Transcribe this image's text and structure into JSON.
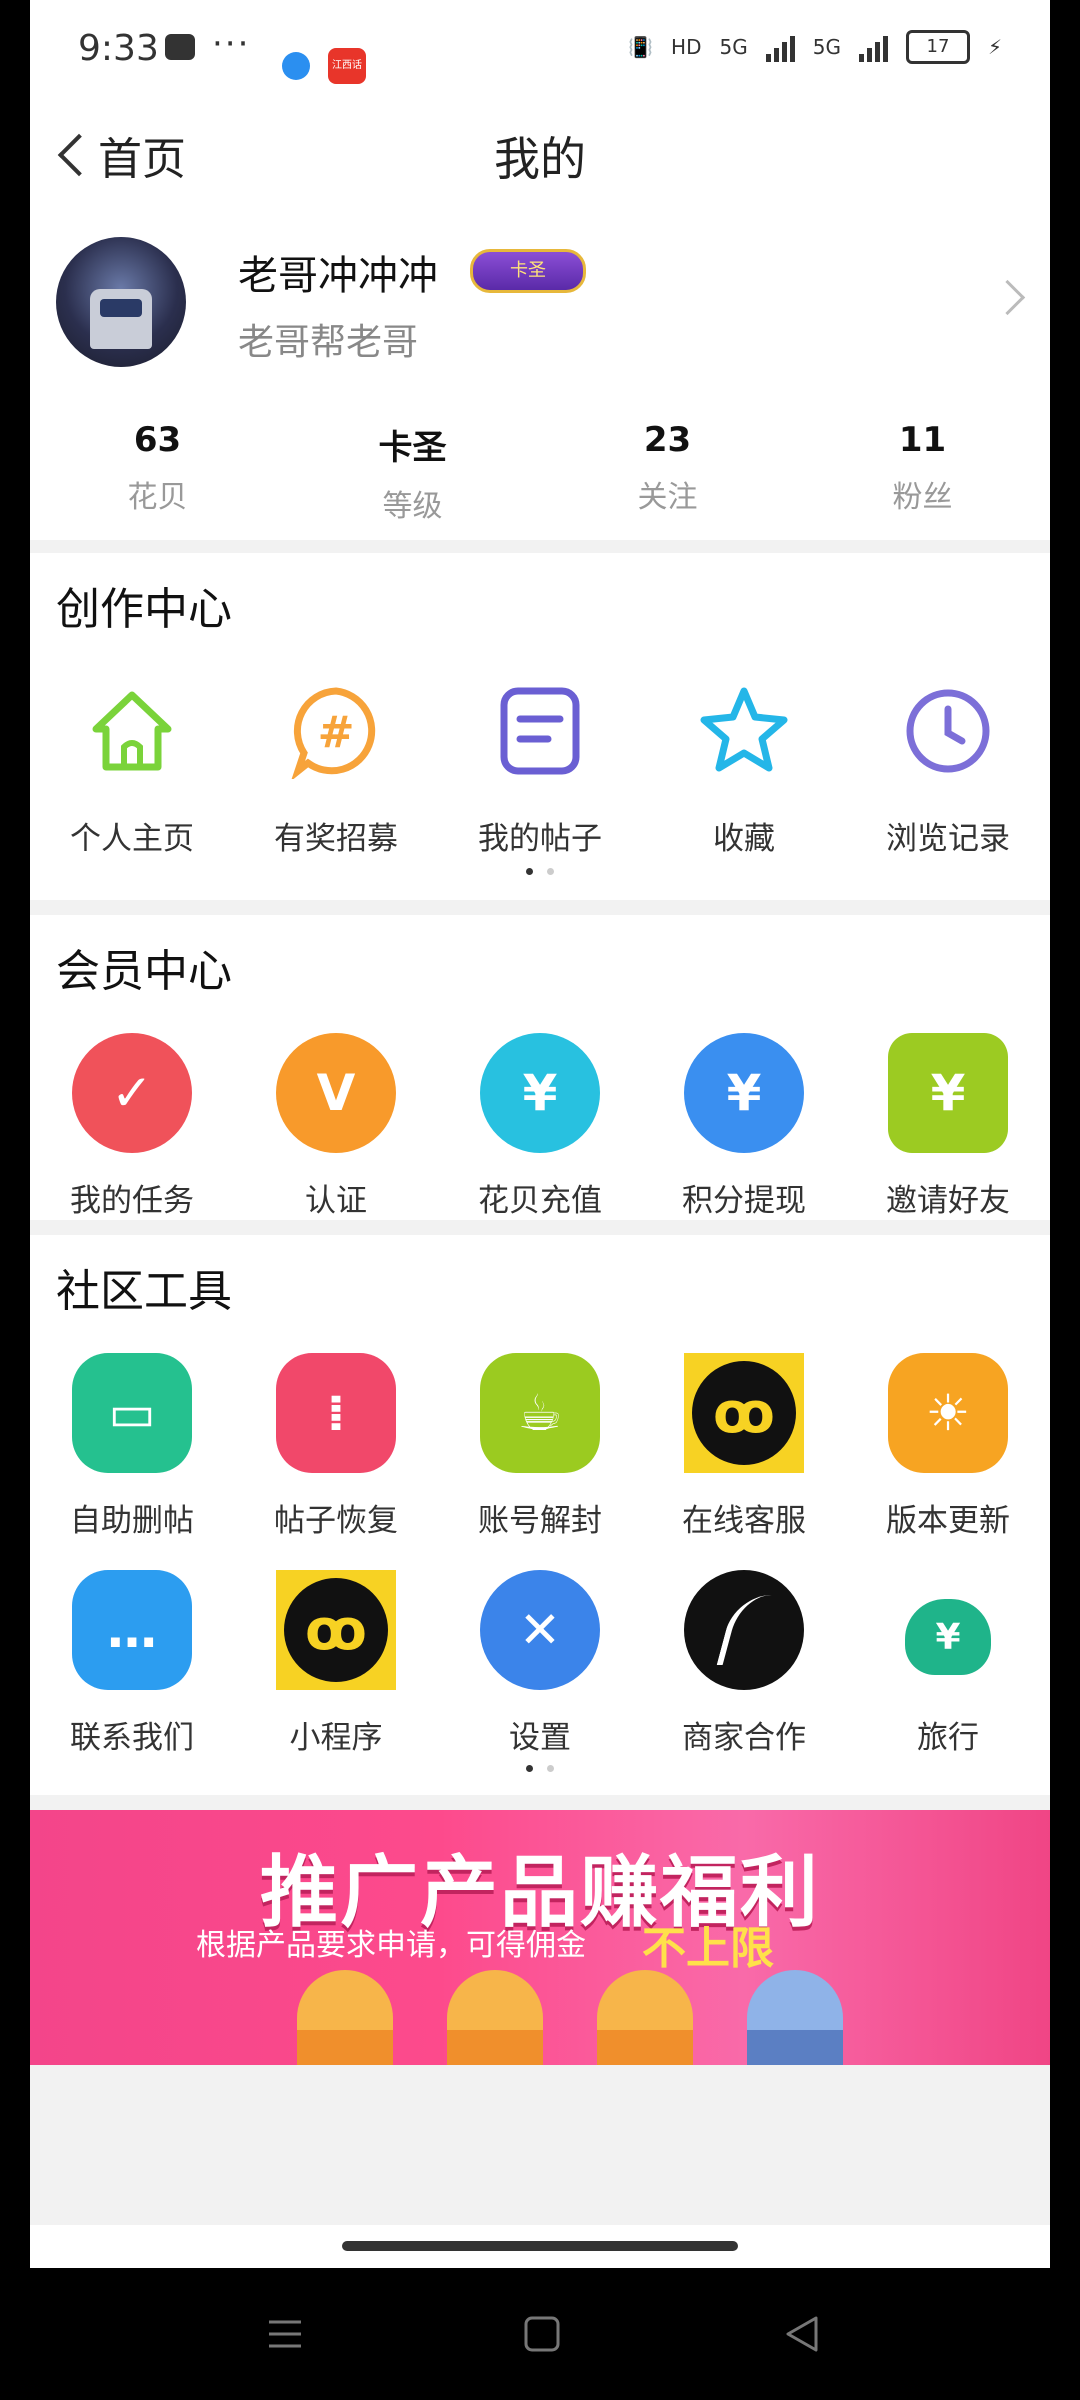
{
  "status_bar": {
    "time": "9:33",
    "dots": "···",
    "app2_label": "江西话",
    "network_hd": "HD",
    "net_5g_1": "5G",
    "net_5g_2": "5G",
    "battery": "17"
  },
  "nav": {
    "back_label": "首页",
    "title": "我的"
  },
  "profile": {
    "name": "老哥冲冲冲",
    "badge": "卡圣",
    "subtitle": "老哥帮老哥",
    "stats": [
      {
        "value": "63",
        "label": "花贝"
      },
      {
        "value": "卡圣",
        "label": "等级"
      },
      {
        "value": "23",
        "label": "关注"
      },
      {
        "value": "11",
        "label": "粉丝"
      }
    ]
  },
  "creation": {
    "title": "创作中心",
    "items": [
      {
        "label": "个人主页",
        "icon": "home-icon"
      },
      {
        "label": "有奖招募",
        "icon": "hashtag-icon"
      },
      {
        "label": "我的帖子",
        "icon": "note-icon"
      },
      {
        "label": "收藏",
        "icon": "star-icon"
      },
      {
        "label": "浏览记录",
        "icon": "clock-icon"
      }
    ]
  },
  "member": {
    "title": "会员中心",
    "items": [
      {
        "label": "我的任务",
        "icon": "task-icon",
        "color": "#f0525a"
      },
      {
        "label": "认证",
        "icon": "vip-icon",
        "color": "#f89a2b"
      },
      {
        "label": "花贝充值",
        "icon": "yuan-recharge-icon",
        "color": "#28c1e0"
      },
      {
        "label": "积分提现",
        "icon": "money-bag-icon",
        "color": "#3a8ff0"
      },
      {
        "label": "邀请好友",
        "icon": "yuan-hand-icon",
        "color": "#9ccb22"
      }
    ]
  },
  "tools": {
    "title": "社区工具",
    "items": [
      {
        "label": "自助删帖",
        "icon": "monitor-icon",
        "color": "#25c18f"
      },
      {
        "label": "帖子恢复",
        "icon": "skewer-icon",
        "color": "#f1486a"
      },
      {
        "label": "账号解封",
        "icon": "coffee-cup-icon",
        "color": "#9bcb20"
      },
      {
        "label": "在线客服",
        "icon": "mini-program-icon",
        "color": "#111111"
      },
      {
        "label": "版本更新",
        "icon": "sun-icon",
        "color": "#f7a422"
      },
      {
        "label": "联系我们",
        "icon": "chat-icon",
        "color": "#2c9df0"
      },
      {
        "label": "小程序",
        "icon": "mini-program-icon",
        "color": "#111111"
      },
      {
        "label": "设置",
        "icon": "wrench-icon",
        "color": "#3b84ea"
      },
      {
        "label": "商家合作",
        "icon": "road-icon",
        "color": "#111111"
      },
      {
        "label": "旅行",
        "icon": "money-bag-icon",
        "color": "#1fb48a"
      }
    ]
  },
  "banner": {
    "headline": "推广产品赚福利",
    "subline": "根据产品要求申请，可得佣金",
    "highlight": "不上限"
  }
}
